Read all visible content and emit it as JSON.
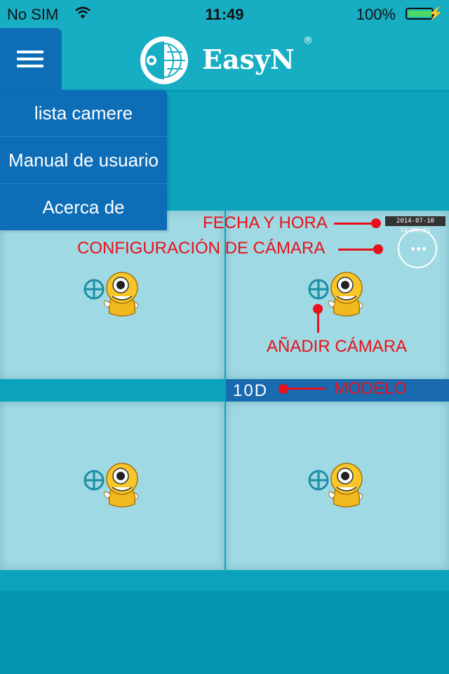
{
  "status_bar": {
    "carrier": "No SIM",
    "time": "11:49",
    "battery_percent": "100%",
    "battery_level": 1.0
  },
  "header": {
    "logo_text": "EasyN",
    "logo_mark": "®"
  },
  "menu": {
    "items": [
      {
        "label": "lista camere"
      },
      {
        "label": "Manual de usuario"
      },
      {
        "label": "Acerca de"
      }
    ]
  },
  "camera_view": {
    "datetime_overlay": "2014-07-10 14:06:01",
    "model": "10D"
  },
  "annotations": {
    "date_time": "FECHA Y HORA",
    "camera_settings": "CONFIGURACIÓN DE CÁMARA",
    "add_camera": "AÑADIR CÁMARA",
    "model": "MODELO"
  },
  "colors": {
    "background": "#0aa3bb",
    "header": "#17aec4",
    "menu": "#0d6db6",
    "cell": "#9fd9e3",
    "annotation": "#e8101b"
  }
}
